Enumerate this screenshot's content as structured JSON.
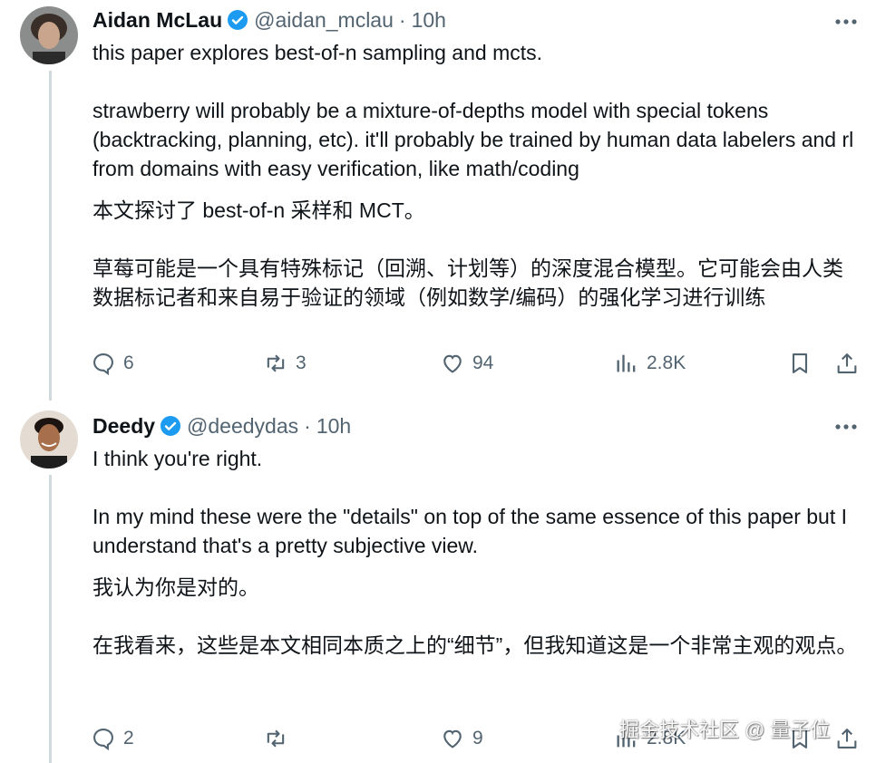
{
  "tweets": [
    {
      "name": "Aidan McLau",
      "handle": "@aidan_mclau",
      "separator": "·",
      "time": "10h",
      "paragraphs": [
        "this paper explores best-of-n sampling and mcts.",
        "strawberry will probably be a mixture-of-depths model with special tokens (backtracking, planning, etc). it'll probably be trained by human data labelers and rl from domains with easy verification, like math/coding"
      ],
      "translation": [
        "本文探讨了 best-of-n 采样和 MCT。",
        "草莓可能是一个具有特殊标记（回溯、计划等）的深度混合模型。它可能会由人类数据标记者和来自易于验证的领域（例如数学/编码）的强化学习进行训练"
      ],
      "replies": "6",
      "reposts": "3",
      "likes": "94",
      "views": "2.8K"
    },
    {
      "name": "Deedy",
      "handle": "@deedydas",
      "separator": "·",
      "time": "10h",
      "paragraphs": [
        "I think you're right.",
        "In my mind these were the \"details\" on top of the same essence of this paper but I understand that's a pretty subjective view."
      ],
      "translation": [
        "我认为你是对的。",
        "在我看来，这些是本文相同本质之上的“细节”，但我知道这是一个非常主观的观点。"
      ],
      "replies": "2",
      "reposts": "",
      "likes": "9",
      "views": "2.8K"
    }
  ],
  "watermark": "掘金技术社区 @ 量子位",
  "colors": {
    "verified": "#1d9bf0",
    "secondary_text": "#536471",
    "thread_line": "#cfd9de"
  }
}
